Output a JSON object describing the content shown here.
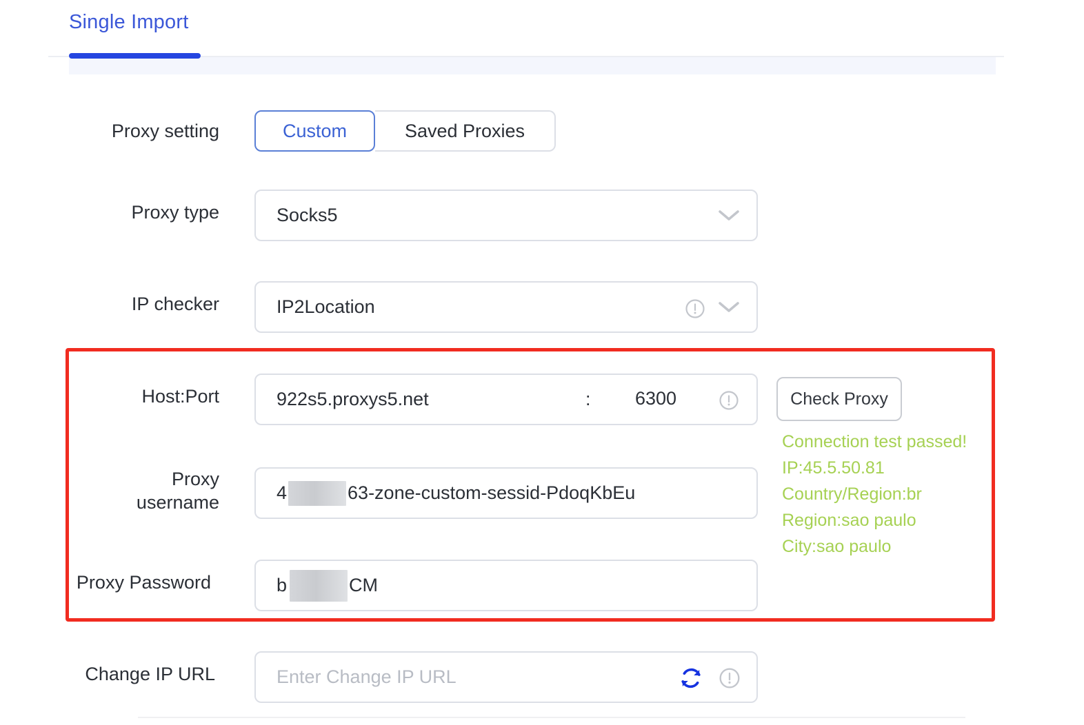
{
  "tabs": [
    {
      "label": "Single Import",
      "active": true
    }
  ],
  "form": {
    "proxy_setting": {
      "label": "Proxy setting",
      "options": [
        "Custom",
        "Saved Proxies"
      ],
      "selected": "Custom"
    },
    "proxy_type": {
      "label": "Proxy type",
      "value": "Socks5",
      "chevron": "chevron-down-icon"
    },
    "ip_checker": {
      "label": "IP checker",
      "value": "IP2Location",
      "info": "info-icon",
      "chevron": "chevron-down-icon"
    },
    "host_port": {
      "label": "Host:Port",
      "host": "922s5.proxys5.net",
      "separator": ":",
      "port": "6300",
      "info": "info-icon",
      "button_label": "Check Proxy"
    },
    "proxy_username": {
      "label": "Proxy\nusername",
      "prefix": "4",
      "suffix": "63-zone-custom-sessid-PdoqKbEu",
      "redacted": true
    },
    "proxy_password": {
      "label": "Proxy Password",
      "prefix": "b",
      "suffix": "CM",
      "redacted": true
    },
    "change_ip_url": {
      "label": "Change IP URL",
      "value": "",
      "placeholder": "Enter Change IP URL",
      "refresh": "refresh-icon",
      "info": "info-icon"
    }
  },
  "connection_result": {
    "status": "Connection test passed!",
    "ip": "IP:45.5.50.81",
    "country": "Country/Region:br",
    "region": "Region:sao paulo",
    "city": "City:sao paulo"
  },
  "colors": {
    "accent_blue": "#2546e0",
    "tab_text": "#3b57d8",
    "success_green": "#a6d153",
    "highlight_red": "#f12c20",
    "refresh_blue": "#1633e0"
  }
}
